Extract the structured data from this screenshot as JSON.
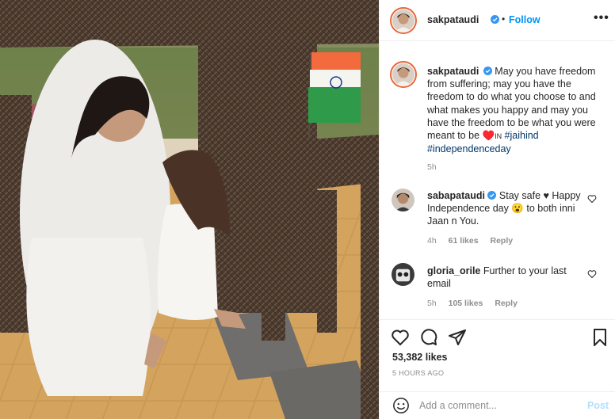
{
  "post": {
    "username": "sakpataudi",
    "follow_label": "Follow",
    "more_label": "•••",
    "separator": "•"
  },
  "caption": {
    "username": "sakpataudi",
    "text": "May you have freedom from suffering; may you have the freedom to do what you choose to and what makes you happy and may you have the freedom to be what you were meant to be ♥️",
    "in_text": "IN",
    "hashtag1": "#jaihind",
    "hashtag2": "#independenceday",
    "time": "5h"
  },
  "comments": [
    {
      "username": "sabapataudi",
      "text": "Stay safe ♥ Happy Independence day 😮 to both inni Jaan n You.",
      "time": "4h",
      "likes": "61 likes",
      "reply": "Reply"
    },
    {
      "username": "gloria_orile",
      "text": "Further to your last email",
      "time": "5h",
      "likes": "105 likes",
      "reply": "Reply"
    }
  ],
  "stats": {
    "likes": "53,382 likes",
    "posted": "5 HOURS AGO"
  },
  "add_comment": {
    "placeholder": "Add a comment...",
    "post_label": "Post"
  },
  "icons": {
    "header_more": "more-options-icon",
    "verified": "verified-badge-icon",
    "like": "heart-icon",
    "comment": "comment-bubble-icon",
    "share": "paper-plane-icon",
    "save": "bookmark-icon",
    "emoji": "smiley-icon"
  },
  "colors": {
    "link": "#0095f6",
    "verified": "#3897f0",
    "hashtag": "#00376b",
    "muted": "#8e8e8e",
    "post_disabled": "#b2dffc"
  }
}
